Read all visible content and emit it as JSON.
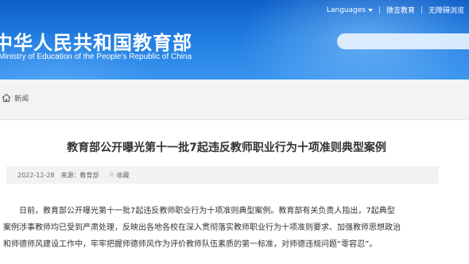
{
  "header": {
    "top_links": {
      "languages": "Languages",
      "microblog": "微言教育",
      "accessibility": "无障碍浏览"
    },
    "site_title_cn": "中华人民共和国教育部",
    "site_title_en": "Ministry of Education of the People's Republic of China",
    "search": {
      "placeholder": ""
    }
  },
  "breadcrumb": {
    "separator": "·",
    "current": "新闻"
  },
  "article": {
    "title": "教育部公开曝光第十一批7起违反教师职业行为十项准则典型案例",
    "date": "2022-12-28",
    "source": "来源：教育部",
    "favorite": "收藏",
    "paragraph_lines": [
      "日前，教育部公开曝光第十一批7起违反教师职业行为十项准则典型案例。教育部有关负责人指出，7起典型",
      "案例涉事教师均已受到严肃处理，反映出各地各校在深入贯彻落实教师职业行为十项准则要求、加强教师思想政治",
      "和师德师风建设工作中，牢牢把握师德师风作为评价教师队伍素质的第一标准，对师德违规问题“零容忍”。"
    ]
  },
  "colors": {
    "header_blue": "#1f7ce0",
    "title_text": "#333333",
    "meta_bg": "#f2f2f2"
  }
}
